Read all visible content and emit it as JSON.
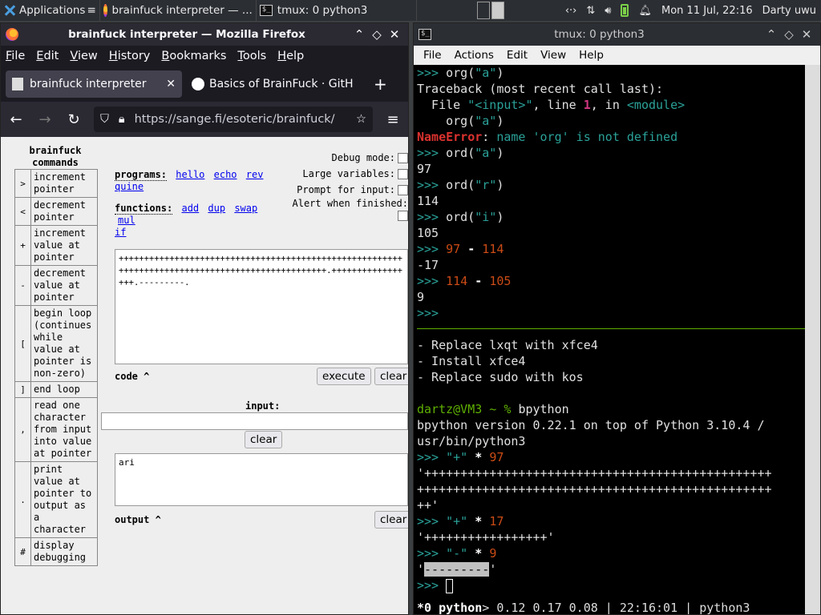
{
  "panel": {
    "apps_label": "Applications",
    "task1": "brainfuck interpreter — ...",
    "task2": "tmux: 0 python3",
    "clock": "Mon 11 Jul, 22:16",
    "user": "Darty uwu"
  },
  "firefox": {
    "title": "brainfuck interpreter — Mozilla Firefox",
    "menu": [
      "File",
      "Edit",
      "View",
      "History",
      "Bookmarks",
      "Tools",
      "Help"
    ],
    "tabs": [
      {
        "label": "brainfuck interpreter"
      },
      {
        "label": "Basics of BrainFuck · GitH"
      }
    ],
    "url": "https://sange.fi/esoteric/brainfuck/"
  },
  "bf_page": {
    "commands_title": "brainfuck commands",
    "commands": [
      {
        "sym": ">",
        "desc": "increment pointer"
      },
      {
        "sym": "<",
        "desc": "decrement pointer"
      },
      {
        "sym": "+",
        "desc": "increment value at pointer"
      },
      {
        "sym": "-",
        "desc": "decrement value at pointer"
      },
      {
        "sym": "[",
        "desc": "begin loop (continues while value at pointer is non-zero)"
      },
      {
        "sym": "]",
        "desc": "end loop"
      },
      {
        "sym": ",",
        "desc": "read one character from input into value at pointer"
      },
      {
        "sym": ".",
        "desc": "print value at pointer to output as a character"
      },
      {
        "sym": "#",
        "desc": "display debugging"
      }
    ],
    "programs_label": "programs:",
    "programs": [
      "hello",
      "echo",
      "rev",
      "quine"
    ],
    "functions_label": "functions:",
    "functions": [
      "add",
      "dup",
      "swap",
      "mul",
      "if"
    ],
    "options": [
      "Debug mode:",
      "Large variables:",
      "Prompt for input:",
      "Alert when finished:"
    ],
    "code": "+++++++++++++++++++++++++++++++++++++++++++++++++++++++++++++++++++++++++++++++++++++++++++++++++.+++++++++++++++++.---------.",
    "code_label": "code ^",
    "execute_label": "execute",
    "clear_label": "clear",
    "input_label": "input:",
    "input_value": "",
    "output_value": "ari",
    "output_label": "output ^"
  },
  "terminal": {
    "title": "tmux: 0 python3",
    "menu": [
      "File",
      "Actions",
      "Edit",
      "View",
      "Help"
    ],
    "notes": [
      "- Replace lxqt with xfce4",
      "- Install xfce4",
      "- Replace sudo with kos"
    ],
    "shell_prompt": "dartz@VM3 ~ % bpython",
    "bpython_banner1": "bpython version 0.22.1 on top of Python 3.10.4 /",
    "bpython_banner2": "usr/bin/python3",
    "status_win": "*0 python",
    "status_rest": "> 0.12 0.17 0.08 | 22:16:01 | python3"
  }
}
